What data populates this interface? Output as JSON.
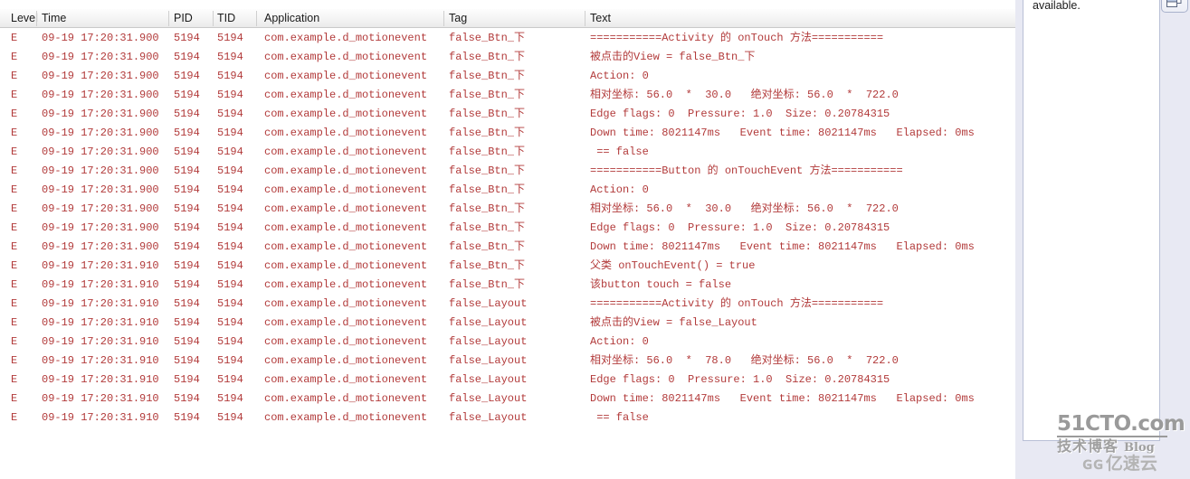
{
  "table": {
    "columns": [
      {
        "key": "level",
        "label": "Level"
      },
      {
        "key": "time",
        "label": "Time"
      },
      {
        "key": "pid",
        "label": "PID"
      },
      {
        "key": "tid",
        "label": "TID"
      },
      {
        "key": "application",
        "label": "Application"
      },
      {
        "key": "tag",
        "label": "Tag"
      },
      {
        "key": "text",
        "label": "Text"
      }
    ],
    "rows": [
      {
        "level": "E",
        "time": "09-19 17:20:31.900",
        "pid": "5194",
        "tid": "5194",
        "application": "com.example.d_motionevent",
        "tag": "false_Btn_下",
        "text": "===========Activity 的 onTouch 方法==========="
      },
      {
        "level": "E",
        "time": "09-19 17:20:31.900",
        "pid": "5194",
        "tid": "5194",
        "application": "com.example.d_motionevent",
        "tag": "false_Btn_下",
        "text": "被点击的View = false_Btn_下"
      },
      {
        "level": "E",
        "time": "09-19 17:20:31.900",
        "pid": "5194",
        "tid": "5194",
        "application": "com.example.d_motionevent",
        "tag": "false_Btn_下",
        "text": "Action: 0"
      },
      {
        "level": "E",
        "time": "09-19 17:20:31.900",
        "pid": "5194",
        "tid": "5194",
        "application": "com.example.d_motionevent",
        "tag": "false_Btn_下",
        "text": "相对坐标: 56.0  *  30.0   绝对坐标: 56.0  *  722.0"
      },
      {
        "level": "E",
        "time": "09-19 17:20:31.900",
        "pid": "5194",
        "tid": "5194",
        "application": "com.example.d_motionevent",
        "tag": "false_Btn_下",
        "text": "Edge flags: 0  Pressure: 1.0  Size: 0.20784315"
      },
      {
        "level": "E",
        "time": "09-19 17:20:31.900",
        "pid": "5194",
        "tid": "5194",
        "application": "com.example.d_motionevent",
        "tag": "false_Btn_下",
        "text": "Down time: 8021147ms   Event time: 8021147ms   Elapsed: 0ms"
      },
      {
        "level": "E",
        "time": "09-19 17:20:31.900",
        "pid": "5194",
        "tid": "5194",
        "application": "com.example.d_motionevent",
        "tag": "false_Btn_下",
        "text": " == false"
      },
      {
        "level": "E",
        "time": "09-19 17:20:31.900",
        "pid": "5194",
        "tid": "5194",
        "application": "com.example.d_motionevent",
        "tag": "false_Btn_下",
        "text": "===========Button 的 onTouchEvent 方法==========="
      },
      {
        "level": "E",
        "time": "09-19 17:20:31.900",
        "pid": "5194",
        "tid": "5194",
        "application": "com.example.d_motionevent",
        "tag": "false_Btn_下",
        "text": "Action: 0"
      },
      {
        "level": "E",
        "time": "09-19 17:20:31.900",
        "pid": "5194",
        "tid": "5194",
        "application": "com.example.d_motionevent",
        "tag": "false_Btn_下",
        "text": "相对坐标: 56.0  *  30.0   绝对坐标: 56.0  *  722.0"
      },
      {
        "level": "E",
        "time": "09-19 17:20:31.900",
        "pid": "5194",
        "tid": "5194",
        "application": "com.example.d_motionevent",
        "tag": "false_Btn_下",
        "text": "Edge flags: 0  Pressure: 1.0  Size: 0.20784315"
      },
      {
        "level": "E",
        "time": "09-19 17:20:31.900",
        "pid": "5194",
        "tid": "5194",
        "application": "com.example.d_motionevent",
        "tag": "false_Btn_下",
        "text": "Down time: 8021147ms   Event time: 8021147ms   Elapsed: 0ms"
      },
      {
        "level": "E",
        "time": "09-19 17:20:31.910",
        "pid": "5194",
        "tid": "5194",
        "application": "com.example.d_motionevent",
        "tag": "false_Btn_下",
        "text": "父类 onTouchEvent() = true"
      },
      {
        "level": "E",
        "time": "09-19 17:20:31.910",
        "pid": "5194",
        "tid": "5194",
        "application": "com.example.d_motionevent",
        "tag": "false_Btn_下",
        "text": "该button touch = false"
      },
      {
        "level": "E",
        "time": "09-19 17:20:31.910",
        "pid": "5194",
        "tid": "5194",
        "application": "com.example.d_motionevent",
        "tag": "false_Layout",
        "text": "===========Activity 的 onTouch 方法==========="
      },
      {
        "level": "E",
        "time": "09-19 17:20:31.910",
        "pid": "5194",
        "tid": "5194",
        "application": "com.example.d_motionevent",
        "tag": "false_Layout",
        "text": "被点击的View = false_Layout"
      },
      {
        "level": "E",
        "time": "09-19 17:20:31.910",
        "pid": "5194",
        "tid": "5194",
        "application": "com.example.d_motionevent",
        "tag": "false_Layout",
        "text": "Action: 0"
      },
      {
        "level": "E",
        "time": "09-19 17:20:31.910",
        "pid": "5194",
        "tid": "5194",
        "application": "com.example.d_motionevent",
        "tag": "false_Layout",
        "text": "相对坐标: 56.0  *  78.0   绝对坐标: 56.0  *  722.0"
      },
      {
        "level": "E",
        "time": "09-19 17:20:31.910",
        "pid": "5194",
        "tid": "5194",
        "application": "com.example.d_motionevent",
        "tag": "false_Layout",
        "text": "Edge flags: 0  Pressure: 1.0  Size: 0.20784315"
      },
      {
        "level": "E",
        "time": "09-19 17:20:31.910",
        "pid": "5194",
        "tid": "5194",
        "application": "com.example.d_motionevent",
        "tag": "false_Layout",
        "text": "Down time: 8021147ms   Event time: 8021147ms   Elapsed: 0ms"
      },
      {
        "level": "E",
        "time": "09-19 17:20:31.910",
        "pid": "5194",
        "tid": "5194",
        "application": "com.example.d_motionevent",
        "tag": "false_Layout",
        "text": " == false"
      }
    ]
  },
  "right_panel": {
    "message": "available.",
    "toolbar_icon": "window-restore-icon"
  },
  "watermarks": {
    "site_main": "51CTO.com",
    "site_sub_cn": "技术博客",
    "site_sub_en": "Blog",
    "secondary_mark": "ɢɢ",
    "secondary": "亿速云"
  },
  "colors": {
    "log_text": "#b23a3a",
    "header_text": "#1a1a1a",
    "panel_bg": "#e8e9f3"
  }
}
